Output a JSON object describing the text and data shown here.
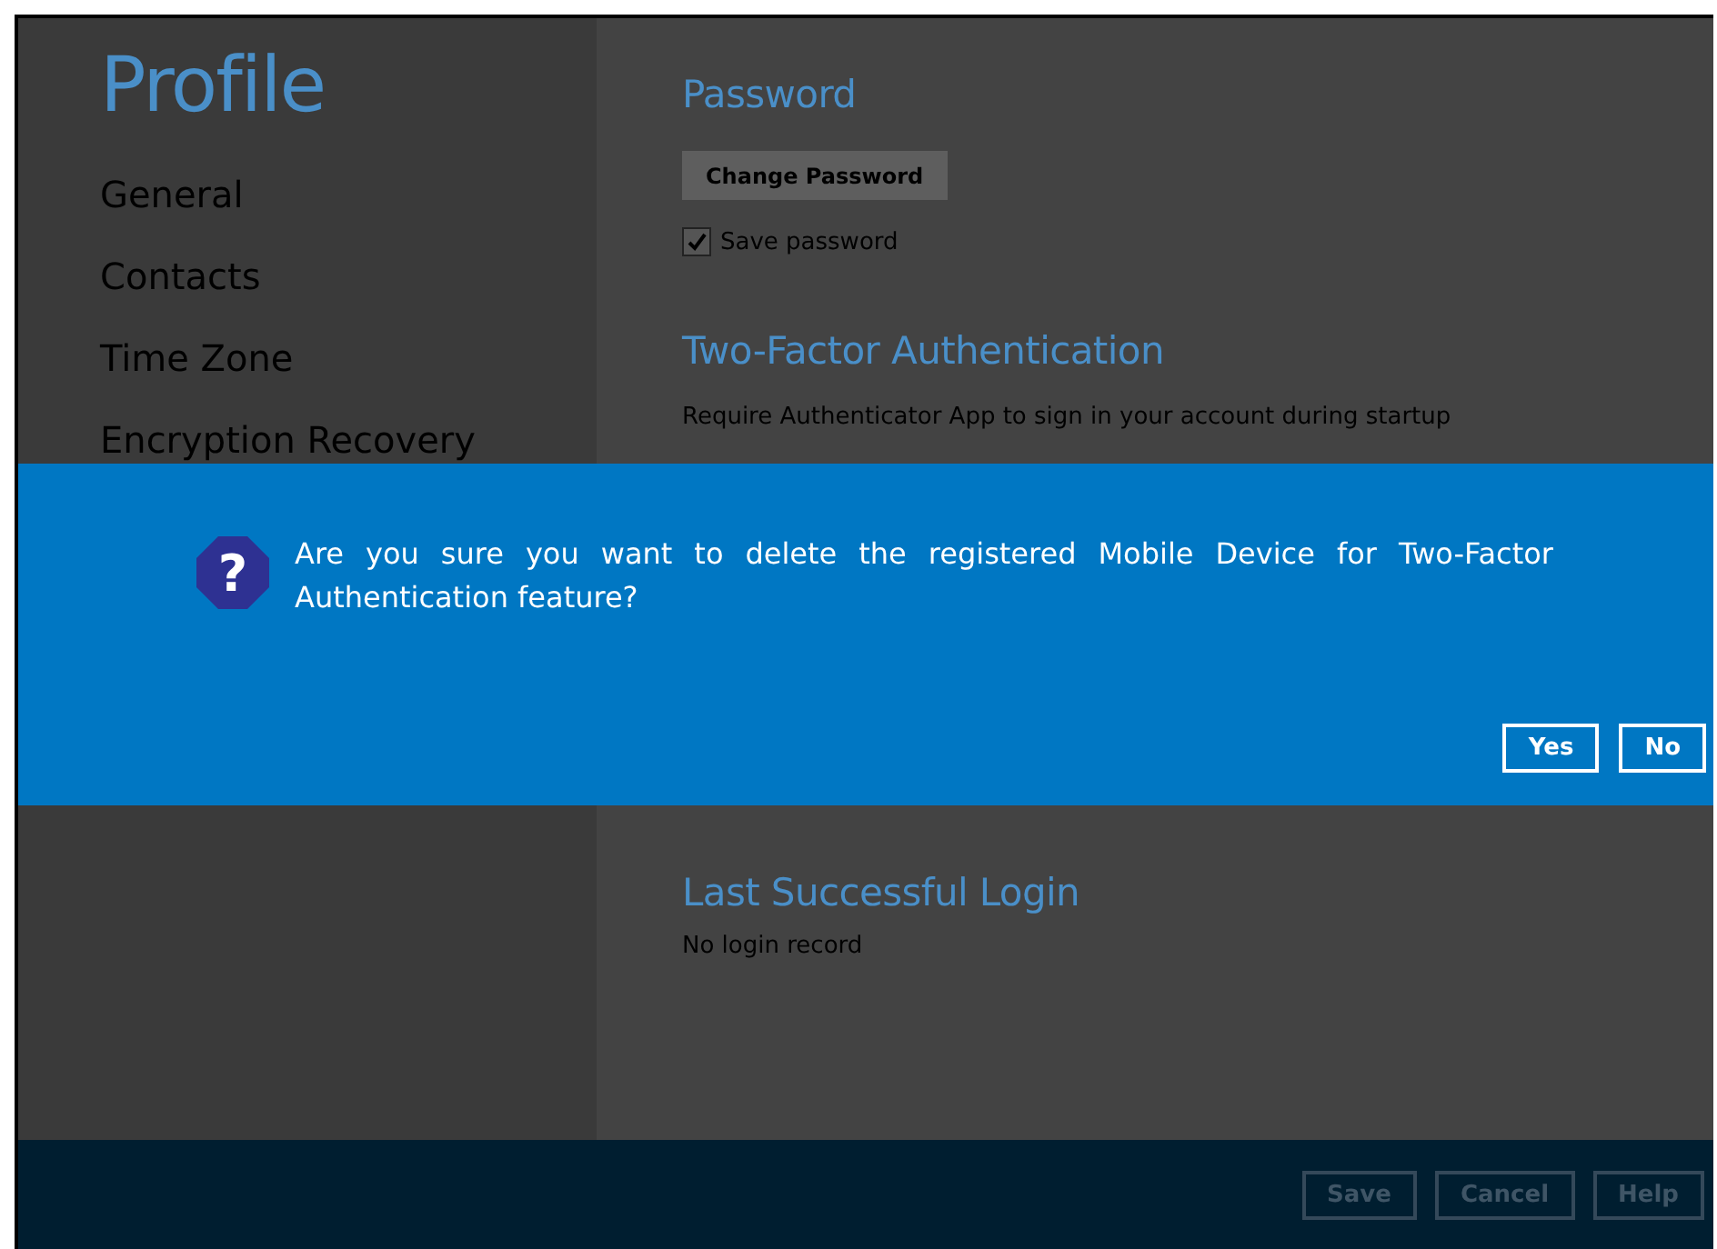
{
  "sidebar": {
    "title": "Profile",
    "items": [
      {
        "label": "General",
        "selected": false
      },
      {
        "label": "Contacts",
        "selected": false
      },
      {
        "label": "Time Zone",
        "selected": false
      },
      {
        "label": "Encryption Recovery",
        "selected": false
      }
    ]
  },
  "password": {
    "heading": "Password",
    "button": "Change Password",
    "save_password": {
      "label": "Save password",
      "checked": true
    }
  },
  "two_factor": {
    "heading": "Two-Factor Authentication",
    "description": "Require Authenticator App to sign in your account during startup"
  },
  "last_login": {
    "heading": "Last Successful Login",
    "value": "No login record"
  },
  "footer": {
    "buttons": [
      "Save",
      "Cancel",
      "Help"
    ]
  },
  "dialog": {
    "icon_glyph": "?",
    "message": "Are you sure you want to delete the registered Mobile Device for Two-Factor Authentication feature?",
    "buttons": [
      "Yes",
      "No"
    ]
  }
}
